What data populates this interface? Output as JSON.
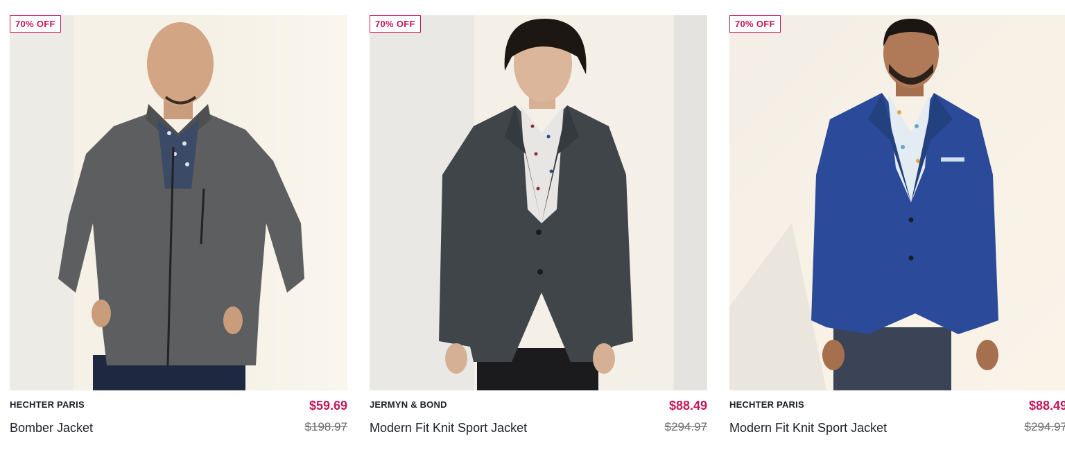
{
  "products": [
    {
      "badge": "70% OFF",
      "brand": "HECHTER PARIS",
      "name": "Bomber Jacket",
      "price": "$59.69",
      "original_price": "$198.97",
      "image_icon": "model-photo-grey-bomber-jacket"
    },
    {
      "badge": "70% OFF",
      "brand": "JERMYN & BOND",
      "name": "Modern Fit Knit Sport Jacket",
      "price": "$88.49",
      "original_price": "$294.97",
      "image_icon": "model-photo-charcoal-sport-jacket"
    },
    {
      "badge": "70% OFF",
      "brand": "HECHTER PARIS",
      "name": "Modern Fit Knit Sport Jacket",
      "price": "$88.49",
      "original_price": "$294.97",
      "image_icon": "model-photo-navy-sport-jacket"
    }
  ],
  "colors": {
    "sale_accent": "#c2185b",
    "text": "#1c1f2a",
    "strikethrough": "#6b6b6b"
  }
}
